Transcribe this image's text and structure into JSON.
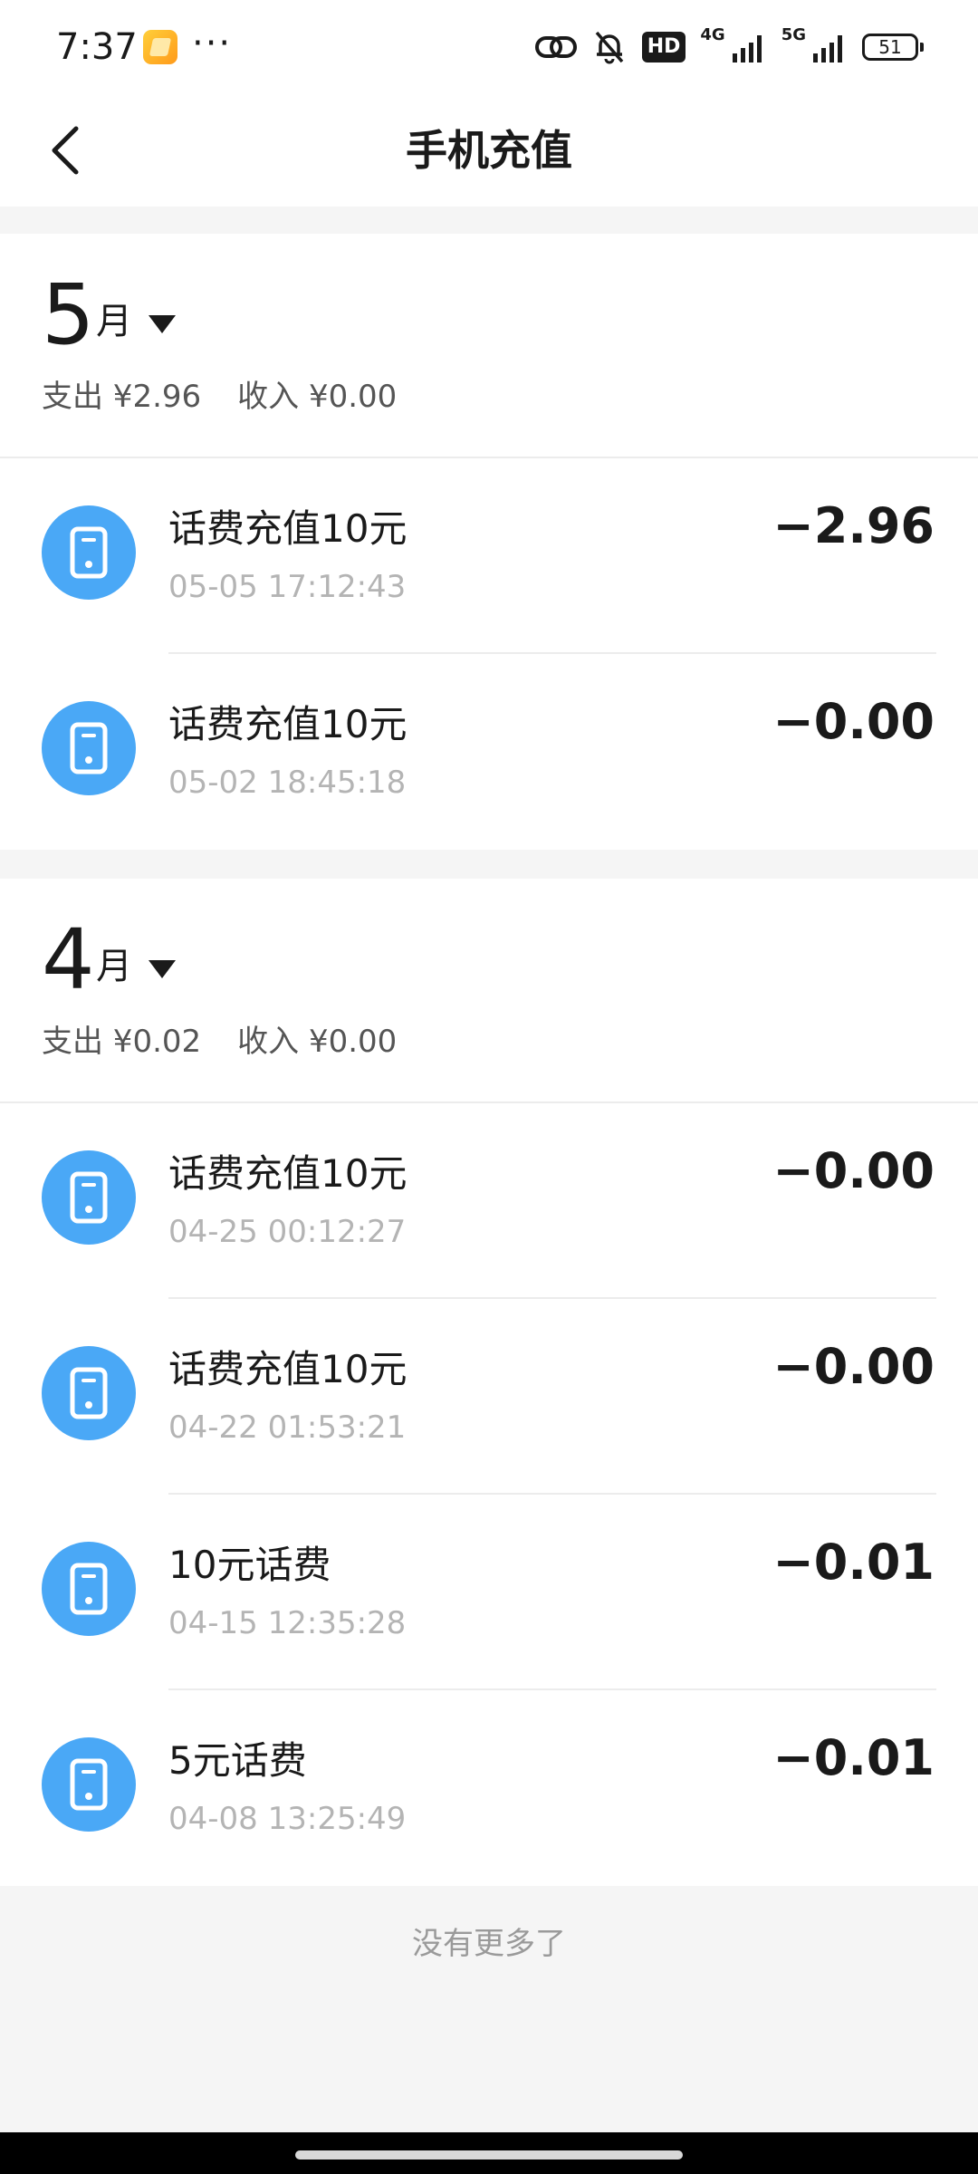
{
  "status_bar": {
    "time": "7:37",
    "more": "···",
    "hd_label": "HD",
    "network_4g": "4G",
    "network_5g": "5G",
    "battery_level": "51",
    "icons": [
      "link-icon",
      "bell-muted-icon",
      "hd-icon",
      "signal-4g-icon",
      "signal-5g-icon",
      "battery-icon"
    ]
  },
  "header": {
    "back_icon": "chevron-left-icon",
    "title": "手机充值"
  },
  "months": [
    {
      "month": "5",
      "unit": "月",
      "expense": "支出 ¥2.96",
      "income": "收入 ¥0.00",
      "transactions": [
        {
          "title": "话费充值10元",
          "time": "05-05 17:12:43",
          "amount": "−2.96",
          "icon": "phone-icon"
        },
        {
          "title": "话费充值10元",
          "time": "05-02 18:45:18",
          "amount": "−0.00",
          "icon": "phone-icon"
        }
      ]
    },
    {
      "month": "4",
      "unit": "月",
      "expense": "支出 ¥0.02",
      "income": "收入 ¥0.00",
      "transactions": [
        {
          "title": "话费充值10元",
          "time": "04-25 00:12:27",
          "amount": "−0.00",
          "icon": "phone-icon"
        },
        {
          "title": "话费充值10元",
          "time": "04-22 01:53:21",
          "amount": "−0.00",
          "icon": "phone-icon"
        },
        {
          "title": "10元话费",
          "time": "04-15 12:35:28",
          "amount": "−0.01",
          "icon": "phone-icon"
        },
        {
          "title": "5元话费",
          "time": "04-08 13:25:49",
          "amount": "−0.01",
          "icon": "phone-icon"
        }
      ]
    }
  ],
  "footer": {
    "no_more": "没有更多了"
  },
  "colors": {
    "accent_blue": "#4aa8f6",
    "page_bg": "#f5f5f5",
    "card_bg": "#ffffff",
    "text_primary": "#1a1a1a",
    "text_secondary": "#b4b4b4"
  }
}
